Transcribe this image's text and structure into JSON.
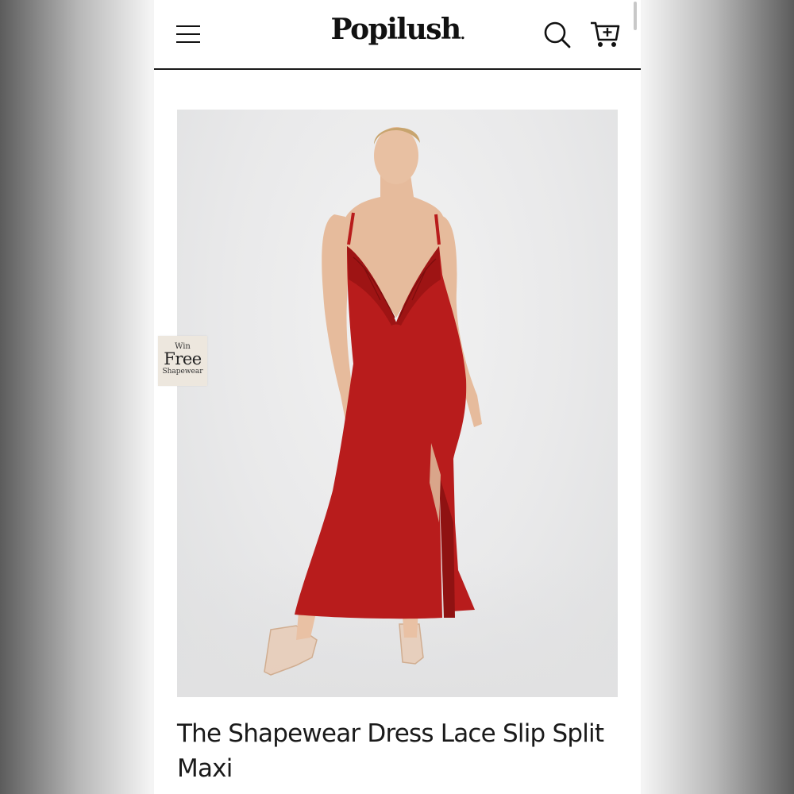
{
  "header": {
    "logo_text": "Popilush",
    "logo_mark": "."
  },
  "icons": {
    "menu": "hamburger-menu-icon",
    "search": "magnifier-icon",
    "cart": "cart-plus-icon"
  },
  "promo": {
    "line1": "Win",
    "line2": "Free",
    "line3": "Shapewear"
  },
  "product": {
    "title": "The Shapewear Dress Lace Slip Split Maxi",
    "image_subject": "model in red lace slip maxi dress with side split",
    "dress_color": "#b81c1c"
  },
  "colors": {
    "text": "#1a1a1a",
    "header_border": "#1a1a1a",
    "badge_bg": "#ede7de",
    "image_bg": "#e9e9ea"
  }
}
